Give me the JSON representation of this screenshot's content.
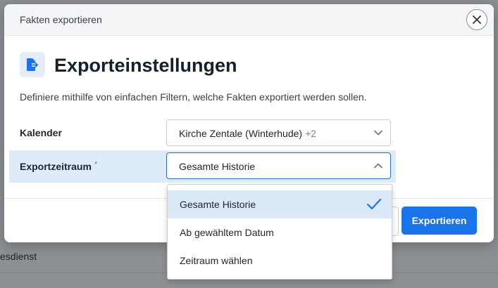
{
  "background": {
    "row_text": "esdienst"
  },
  "modal": {
    "window_title": "Fakten exportieren",
    "close_icon": "close-icon",
    "heading_icon": "file-export-icon",
    "heading": "Exporteinstellungen",
    "description": "Definiere mithilfe von einfachen Filtern, welche Fakten exportiert werden sollen.",
    "fields": {
      "calendar": {
        "label": "Kalender",
        "value": "Kirche Zentale (Winterhude)",
        "extra_count": "+2"
      },
      "period": {
        "label": "Exportzeitraum",
        "required_mark": "*",
        "value": "Gesamte Historie"
      }
    },
    "export_button": "Exportieren"
  },
  "dropdown": {
    "options": [
      {
        "label": "Gesamte Historie",
        "selected": true
      },
      {
        "label": "Ab gewähltem Datum",
        "selected": false
      },
      {
        "label": "Zeitraum wählen",
        "selected": false
      }
    ]
  },
  "colors": {
    "accent": "#1a73e8",
    "selected_bg": "#dbe8f7",
    "highlight_row": "#deebf8"
  }
}
